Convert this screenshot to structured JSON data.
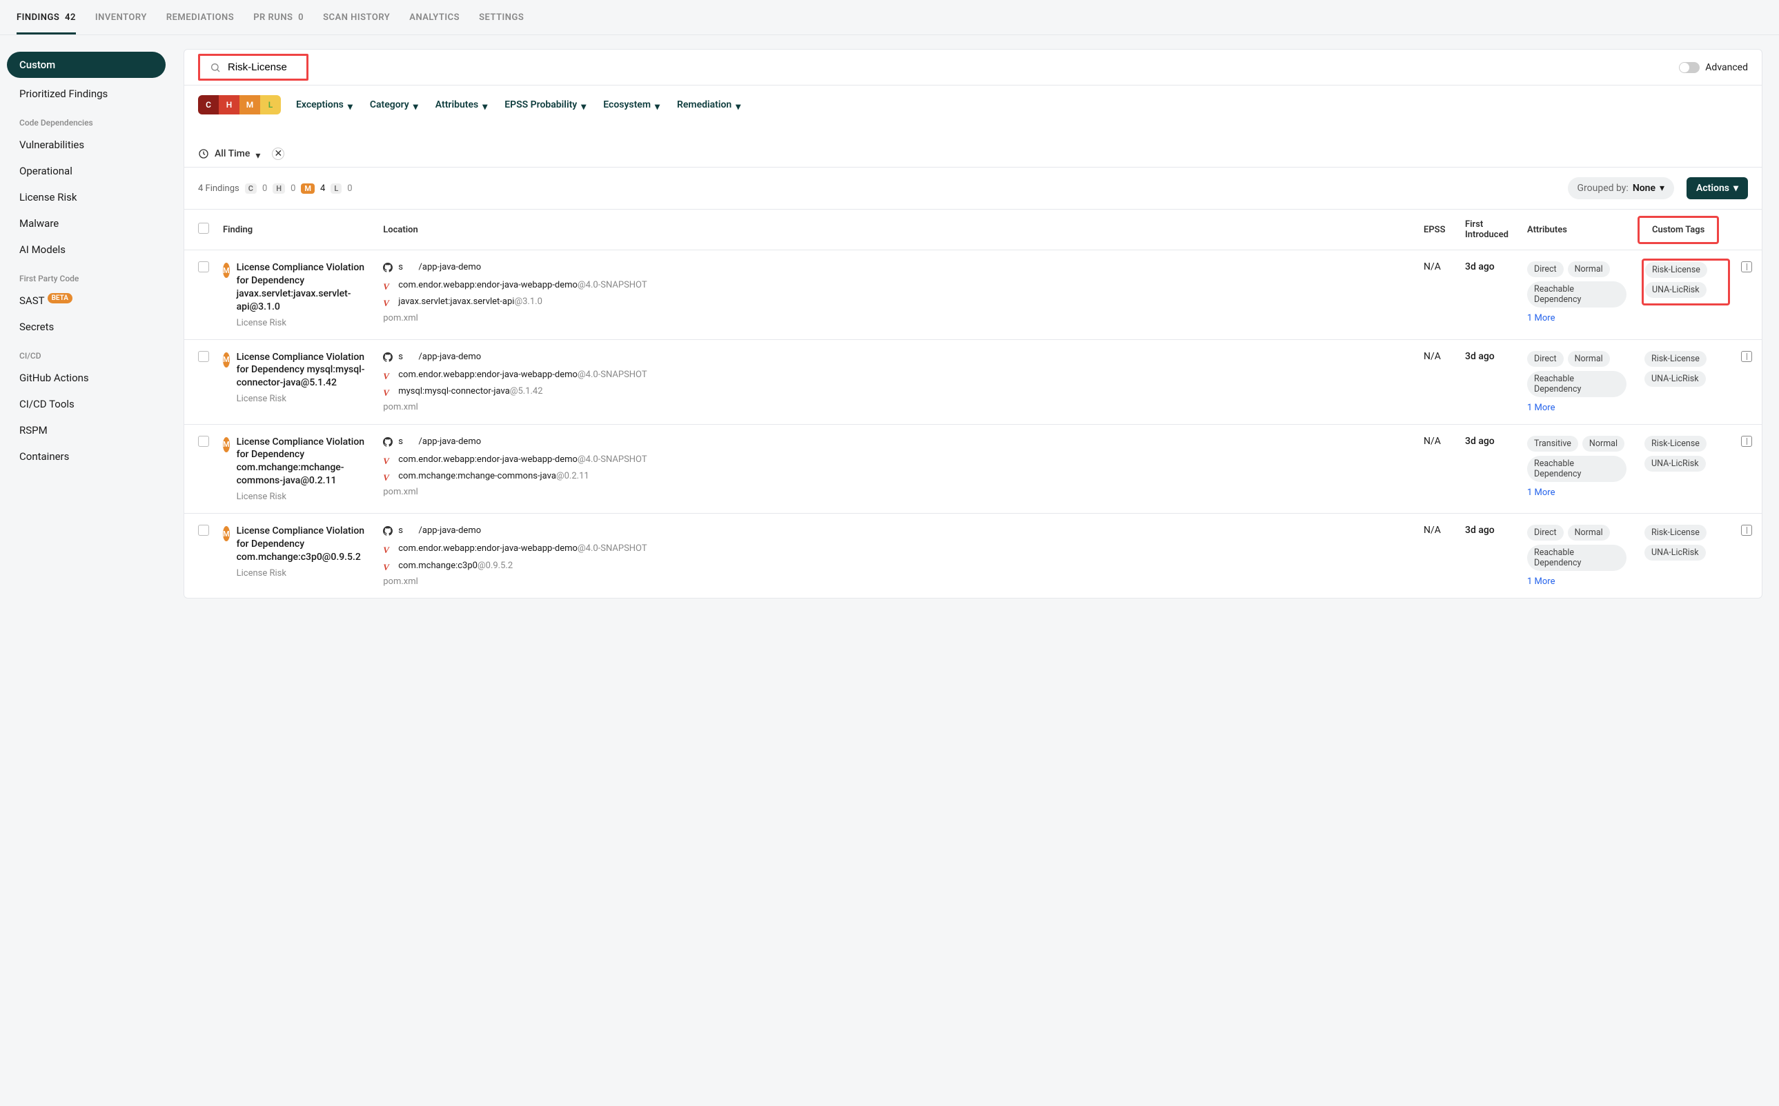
{
  "topnav": [
    {
      "label": "FINDINGS",
      "count": "42",
      "active": true
    },
    {
      "label": "INVENTORY"
    },
    {
      "label": "REMEDIATIONS"
    },
    {
      "label": "PR RUNS",
      "count": "0"
    },
    {
      "label": "SCAN HISTORY"
    },
    {
      "label": "ANALYTICS"
    },
    {
      "label": "SETTINGS"
    }
  ],
  "sidebar": {
    "custom": "Custom",
    "prioritized": "Prioritized Findings",
    "section_deps": "Code Dependencies",
    "deps": [
      "Vulnerabilities",
      "Operational",
      "License Risk",
      "Malware",
      "AI Models"
    ],
    "section_fpc": "First Party Code",
    "sast": "SAST",
    "beta": "BETA",
    "secrets": "Secrets",
    "section_cicd": "CI/CD",
    "cicd": [
      "GitHub Actions",
      "CI/CD Tools",
      "RSPM"
    ],
    "containers": "Containers"
  },
  "search": {
    "value": "Risk-License",
    "advanced": "Advanced"
  },
  "filters": {
    "exceptions": "Exceptions",
    "category": "Category",
    "attributes": "Attributes",
    "epss": "EPSS Probability",
    "eco": "Ecosystem",
    "remediation": "Remediation",
    "time": "All Time"
  },
  "sev": {
    "c": "C",
    "h": "H",
    "m": "M",
    "l": "L"
  },
  "summary": {
    "findings": "4 Findings",
    "c": "0",
    "h": "0",
    "m": "4",
    "l": "0",
    "grouped_label": "Grouped by:",
    "grouped_val": "None",
    "actions": "Actions"
  },
  "cols": {
    "finding": "Finding",
    "location": "Location",
    "epss": "EPSS",
    "first": "First Introduced",
    "attrs": "Attributes",
    "tags": "Custom Tags"
  },
  "repo_label": "s",
  "repo_path": "/app-java-demo",
  "pkg": "com.endor.webapp:endor-java-webapp-demo",
  "pkg_ver": "@4.0-SNAPSHOT",
  "file": "pom.xml",
  "more": "1 More",
  "rows": [
    {
      "title": "License Compliance Violation for Dependency javax.servlet:javax.servlet-api@3.1.0",
      "sub": "License Risk",
      "dep": "javax.servlet:javax.servlet-api",
      "depv": "@3.1.0",
      "epss": "N/A",
      "first": "3d ago",
      "attrs": [
        "Direct",
        "Normal",
        "Reachable Dependency"
      ],
      "tags": [
        "Risk-License",
        "UNA-LicRisk"
      ],
      "highlight_tags": true
    },
    {
      "title": "License Compliance Violation for Dependency mysql:mysql-connector-java@5.1.42",
      "sub": "License Risk",
      "dep": "mysql:mysql-connector-java",
      "depv": "@5.1.42",
      "epss": "N/A",
      "first": "3d ago",
      "attrs": [
        "Direct",
        "Normal",
        "Reachable Dependency"
      ],
      "tags": [
        "Risk-License",
        "UNA-LicRisk"
      ]
    },
    {
      "title": "License Compliance Violation for Dependency com.mchange:mchange-commons-java@0.2.11",
      "sub": "License Risk",
      "dep": "com.mchange:mchange-commons-java",
      "depv": "@0.2.11",
      "epss": "N/A",
      "first": "3d ago",
      "attrs": [
        "Transitive",
        "Normal",
        "Reachable Dependency"
      ],
      "tags": [
        "Risk-License",
        "UNA-LicRisk"
      ]
    },
    {
      "title": "License Compliance Violation for Dependency com.mchange:c3p0@0.9.5.2",
      "sub": "License Risk",
      "dep": "com.mchange:c3p0",
      "depv": "@0.9.5.2",
      "epss": "N/A",
      "first": "3d ago",
      "attrs": [
        "Direct",
        "Normal",
        "Reachable Dependency"
      ],
      "tags": [
        "Risk-License",
        "UNA-LicRisk"
      ]
    }
  ]
}
